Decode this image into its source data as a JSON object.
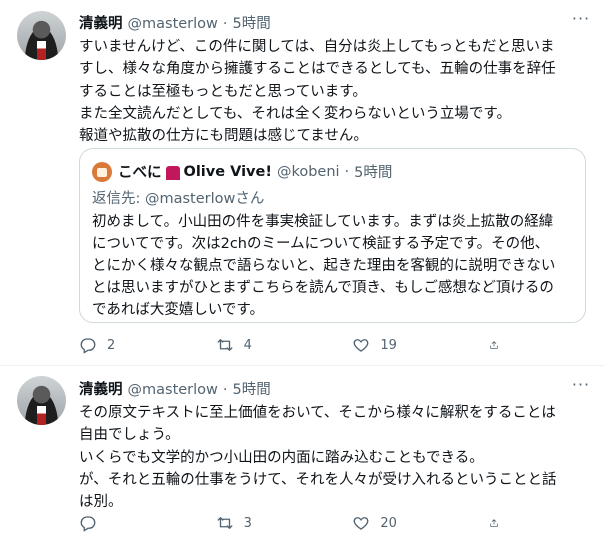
{
  "tweets": [
    {
      "name": "清義明",
      "handle": "@masterlow",
      "dot": "·",
      "time": "5時間",
      "text_lines": [
        "すいませんけど、この件に関しては、自分は炎上してもっともだと思いま",
        "すし、様々な角度から擁護することはできるとしても、五輪の仕事を辞任",
        "することは至極もっともだと思っています。",
        "また全文読んだとしても、それは全く変わらないという立場です。",
        "報道や拡散の仕方にも問題は感じてません。"
      ],
      "quote": {
        "name_prefix": "こべに",
        "name_suffix": "Olive Vive!",
        "handle": "@kobeni",
        "dot": "·",
        "time": "5時間",
        "reply_to": "返信先: @masterlowさん",
        "text_lines": [
          "初めまして。小山田の件を事実検証しています。まずは炎上拡散の経緯",
          "についてです。次は2chのミームについて検証する予定です。その他、",
          "とにかく様々な観点で語らないと、起きた理由を客観的に説明できない",
          "とは思いますがひとまずこちらを読んで頂き、もしご感想など頂けるの",
          "であれば大変嬉しいです。"
        ]
      },
      "actions": {
        "replies": "2",
        "retweets": "4",
        "likes": "19"
      }
    },
    {
      "name": "清義明",
      "handle": "@masterlow",
      "dot": "·",
      "time": "5時間",
      "text_lines": [
        "その原文テキストに至上価値をおいて、そこから様々に解釈をすることは",
        "自由でしょう。",
        "いくらでも文学的かつ小山田の内面に踏み込むこともできる。",
        "が、それと五輪の仕事をうけて、それを人々が受け入れるということと話",
        "は別。"
      ],
      "actions": {
        "replies": "",
        "retweets": "3",
        "likes": "20"
      }
    }
  ],
  "icons": {
    "more": "more-icon",
    "reply": "reply-icon",
    "retweet": "retweet-icon",
    "like": "heart-icon",
    "share": "share-icon"
  }
}
